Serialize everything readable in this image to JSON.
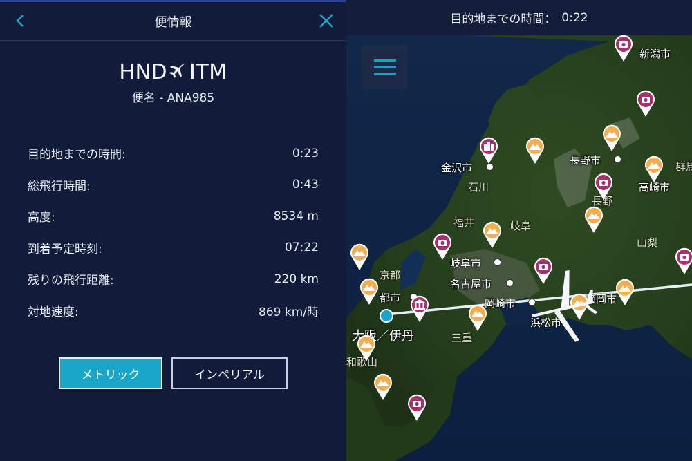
{
  "panel": {
    "title": "便情報",
    "origin": "HND",
    "destination": "ITM",
    "flight_label": "便名 - ANA985",
    "stats": [
      {
        "label": "目的地までの時間:",
        "value": "0:23"
      },
      {
        "label": "総飛行時間:",
        "value": "0:43"
      },
      {
        "label": "高度:",
        "value": "8534 m"
      },
      {
        "label": "到着予定時刻:",
        "value": "07:22"
      },
      {
        "label": "残りの飛行距離:",
        "value": "220 km"
      },
      {
        "label": "対地速度:",
        "value": "869 km/時"
      }
    ],
    "metric_label": "メトリック",
    "imperial_label": "インペリアル",
    "accent_color": "#19a6c8"
  },
  "map": {
    "header_label": "目的地までの時間：",
    "header_value": "0:22",
    "cities": {
      "niigata": "新潟市",
      "kanazawa": "金沢市",
      "nagano": "長野市",
      "takasaki": "高崎市",
      "gifu": "岐阜市",
      "nagoya": "名古屋市",
      "okazaki": "岡崎市",
      "shizuoka": "静岡市",
      "hamamatsu": "浜松市",
      "kyoto_city": "都市"
    },
    "prefectures": {
      "ishikawa": "石川",
      "fukui": "福井",
      "gifu": "岐阜",
      "yamanashi": "山梨",
      "nagano": "長野",
      "kyoto": "京都",
      "mie": "三重",
      "wakayama": "和歌山",
      "gunma": "群馬"
    },
    "airport_label": "大阪／伊丹",
    "icons": [
      "menu-icon",
      "camera-icon",
      "mountain-icon",
      "city-icon",
      "museum-icon",
      "airplane-icon"
    ]
  }
}
